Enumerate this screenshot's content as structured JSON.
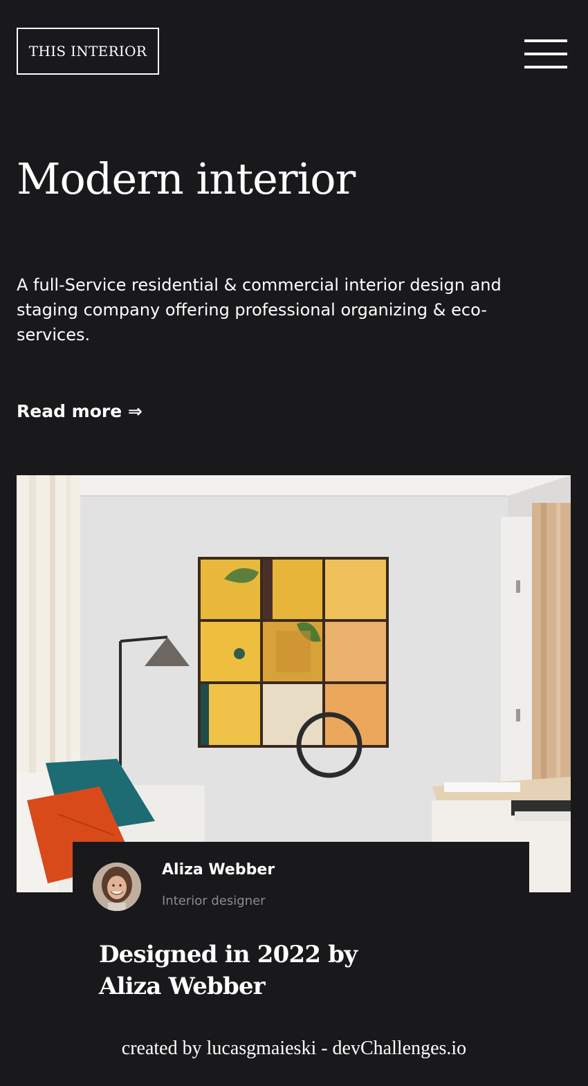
{
  "header": {
    "logo_text": "THIS INTERIOR",
    "menu_icon": "hamburger-menu-icon"
  },
  "hero": {
    "title": "Modern interior",
    "description": "A full-Service residential & commercial interior design and staging company offering professional organizing & eco-services.",
    "read_more_label": "Read more ⇒"
  },
  "photo": {
    "subject": "living-room-photo"
  },
  "card": {
    "author_name": "Aliza Webber",
    "author_role": "Interior designer",
    "title": "Designed in 2022 by Aliza Webber"
  },
  "footer": {
    "credit": "created by lucasgmaieski - devChallenges.io"
  },
  "colors": {
    "background": "#19181b",
    "text": "#ffffff",
    "muted_text": "#8c8c8c"
  }
}
